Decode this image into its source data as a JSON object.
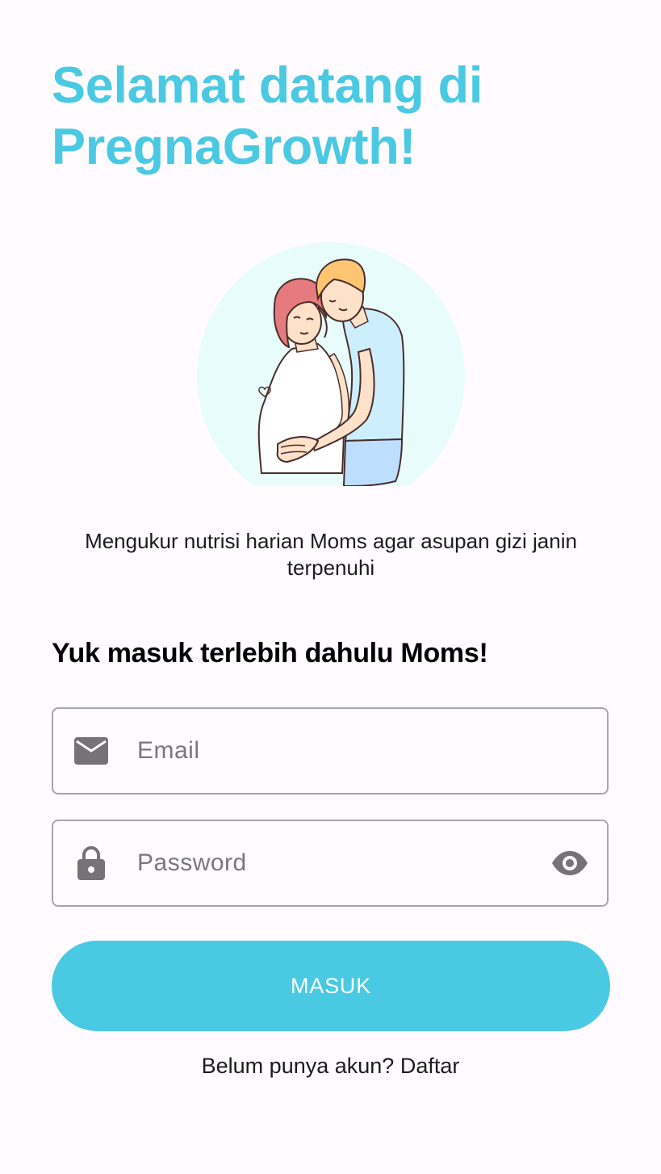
{
  "colors": {
    "accent": "#4ac9e3",
    "illustration_bg": "#e8fdfb"
  },
  "header": {
    "title_line1": "Selamat datang di",
    "title_line2": "PregnaGrowth!"
  },
  "illustration": {
    "icon": "pregnant-couple-illustration"
  },
  "tagline": "Mengukur nutrisi harian Moms agar asupan gizi janin terpenuhi",
  "login": {
    "heading": "Yuk masuk terlebih dahulu Moms!",
    "email": {
      "placeholder": "Email",
      "value": "",
      "icon": "mail-icon"
    },
    "password": {
      "placeholder": "Password",
      "value": "",
      "icon": "lock-icon",
      "toggle_icon": "eye-icon"
    },
    "submit_label": "MASUK",
    "register_prompt": "Belum punya akun?",
    "register_link": "Daftar"
  }
}
